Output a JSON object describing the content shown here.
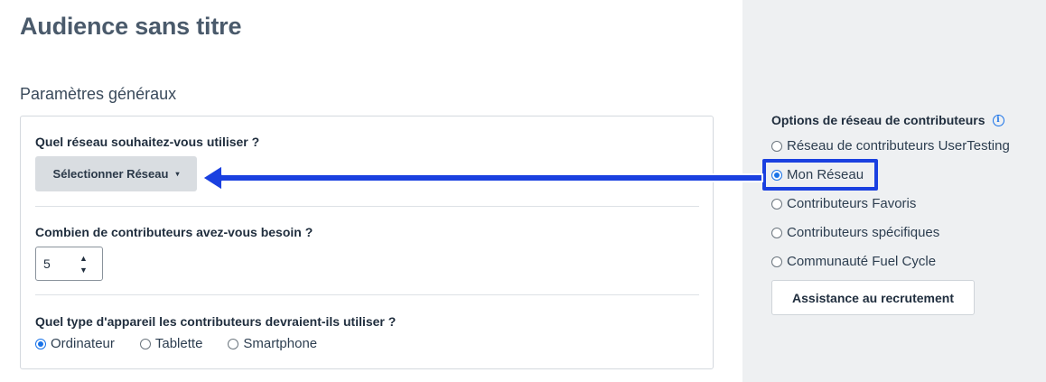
{
  "page_title": "Audience sans titre",
  "section_title": "Paramètres généraux",
  "network_question": {
    "label": "Quel réseau souhaitez-vous utiliser ?",
    "select_label": "Sélectionner Réseau",
    "caret": "▾"
  },
  "contributors_question": {
    "label": "Combien de contributeurs avez-vous besoin ?",
    "value": "5",
    "up": "▲",
    "down": "▼"
  },
  "device_question": {
    "label": "Quel type d'appareil les contributeurs devraient-ils utiliser ?",
    "options": [
      "Ordinateur",
      "Tablette",
      "Smartphone"
    ],
    "selected": "Ordinateur"
  },
  "sidebar": {
    "title": "Options de réseau de contributeurs",
    "info_icon": "i",
    "options": [
      "Réseau de contributeurs UserTesting",
      "Mon Réseau",
      "Contributeurs Favoris",
      "Contributeurs spécifiques",
      "Communauté Fuel Cycle"
    ],
    "selected": "Mon Réseau",
    "assist_button": "Assistance au recrutement"
  },
  "colors": {
    "accent": "#1a73e8",
    "annotation": "#1a40e0",
    "sidebar_bg": "#eef0f2"
  }
}
